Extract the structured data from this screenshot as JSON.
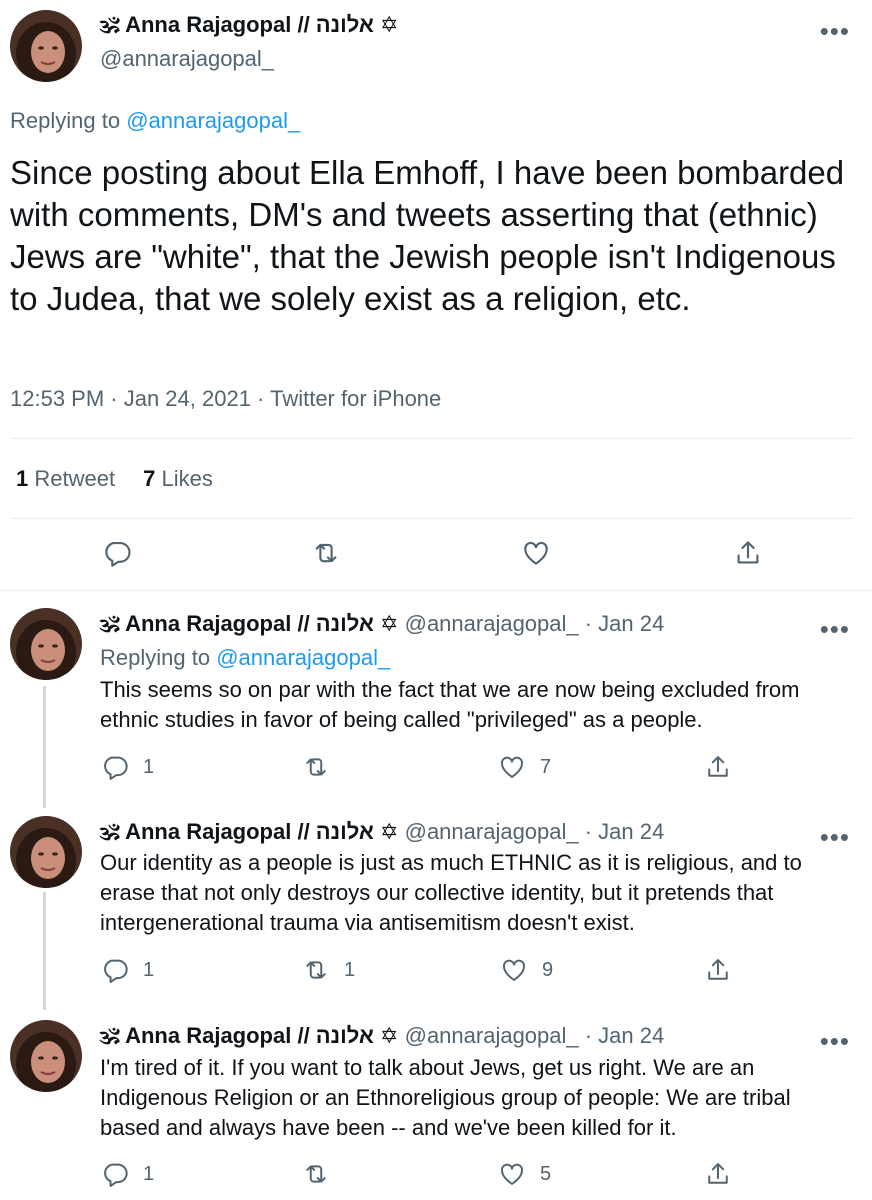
{
  "main": {
    "display_name": "🕉 Anna Rajagopal // אלונה ✡",
    "handle": "@annarajagopal_",
    "replying_prefix": "Replying to",
    "replying_handle": "@annarajagopal_",
    "text": "Since posting about Ella Emhoff, I have been bombarded with comments, DM's and tweets asserting that (ethnic) Jews are \"white\", that the Jewish people isn't Indigenous to Judea, that we solely exist as a religion, etc.",
    "meta": "12:53 PM · Jan 24, 2021 · Twitter for iPhone",
    "retweets_count": "1",
    "retweets_label": "Retweet",
    "likes_count": "7",
    "likes_label": "Likes"
  },
  "replies": [
    {
      "display_name": "🕉 Anna Rajagopal // אלונה ✡",
      "handle_date": "@annarajagopal_ · Jan 24",
      "replying_prefix": "Replying to",
      "replying_handle": "@annarajagopal_",
      "text": "This seems so on par with the fact that we are now being excluded from ethnic studies in favor of being called \"privileged\" as a people.",
      "reply_count": "1",
      "retweet_count": "",
      "like_count": "7"
    },
    {
      "display_name": "🕉 Anna Rajagopal // אלונה ✡",
      "handle_date": "@annarajagopal_ · Jan 24",
      "text": "Our identity as a people is just as much ETHNIC as it is religious, and to erase that not only destroys our collective identity, but it pretends that intergenerational trauma via antisemitism doesn't exist.",
      "reply_count": "1",
      "retweet_count": "1",
      "like_count": "9"
    },
    {
      "display_name": "🕉 Anna Rajagopal // אלונה ✡",
      "handle_date": "@annarajagopal_ · Jan 24",
      "text": "I'm tired of it. If you want to talk about Jews, get us right. We are an Indigenous Religion or an Ethnoreligious group of people: We are tribal based and always have been -- and we've been killed for it.",
      "reply_count": "1",
      "retweet_count": "",
      "like_count": "5"
    }
  ],
  "icons": {
    "more": "more-horizontal-icon",
    "reply": "reply-icon",
    "retweet": "retweet-icon",
    "like": "heart-icon",
    "share": "share-icon"
  },
  "colors": {
    "link": "#1d9bf0",
    "secondary": "#536471",
    "text": "#0f1419"
  },
  "more_glyph": "•••"
}
